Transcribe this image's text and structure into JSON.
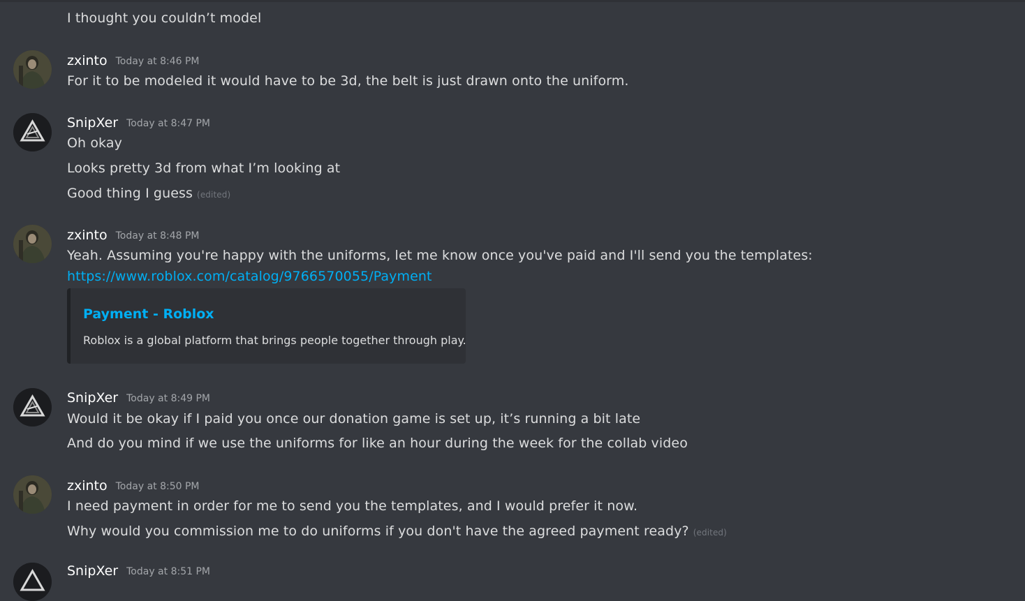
{
  "colors": {
    "background": "#36393f",
    "text": "#dcddde",
    "username": "#ffffff",
    "timestamp": "#a3a6aa",
    "link": "#00aff4",
    "embed_bg": "#2f3136"
  },
  "messages": {
    "m0": {
      "lines": [
        "I thought you couldn’t model"
      ]
    },
    "m1": {
      "author": "zxinto",
      "timestamp": "Today at 8:46 PM",
      "lines": [
        "For it to be modeled it would have to be 3d, the belt is just drawn onto the uniform."
      ]
    },
    "m2": {
      "author": "SnipXer",
      "timestamp": "Today at 8:47 PM",
      "lines": [
        "Oh okay",
        "Looks pretty 3d from what I’m looking at",
        "Good thing I guess"
      ],
      "edited": "(edited)"
    },
    "m3": {
      "author": "zxinto",
      "timestamp": "Today at 8:48 PM",
      "lines": [
        "Yeah. Assuming you're happy with the uniforms, let me know once you've paid and I'll send you the templates:"
      ],
      "link": "https://www.roblox.com/catalog/9766570055/Payment",
      "embed": {
        "title": "Payment - Roblox",
        "description": "Roblox is a global platform that brings people together through play."
      }
    },
    "m4": {
      "author": "SnipXer",
      "timestamp": "Today at 8:49 PM",
      "lines": [
        "Would it be okay if I paid you once our donation game is set up, it’s running a bit late",
        "And do you mind if we use the uniforms for like an hour during the week for the collab video"
      ]
    },
    "m5": {
      "author": "zxinto",
      "timestamp": "Today at 8:50 PM",
      "lines": [
        "I need payment in order for me to send you the templates, and I would prefer it now.",
        "Why would you commission me to do uniforms if you don't have the agreed payment ready?"
      ],
      "edited": "(edited)"
    },
    "m6": {
      "author": "SnipXer",
      "timestamp": "Today at 8:51 PM"
    }
  },
  "icons": {
    "zxinto_avatar": "user-photo-avatar",
    "snipxer_avatar": "triangle-logo-avatar"
  }
}
